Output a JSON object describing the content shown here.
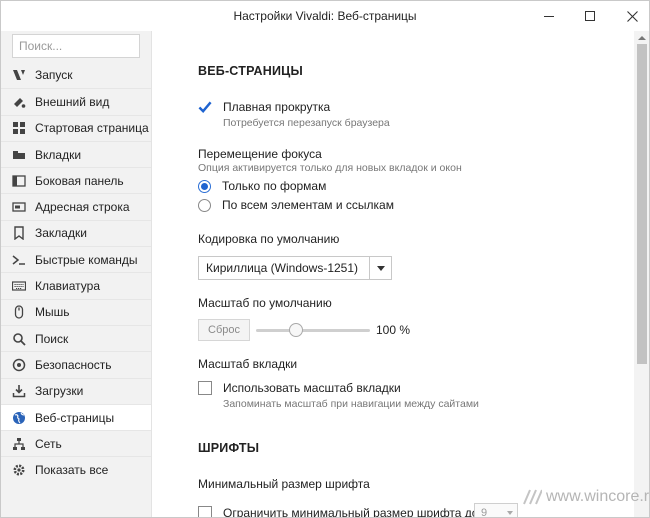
{
  "window": {
    "title": "Настройки Vivaldi: Веб-страницы"
  },
  "sidebar": {
    "search_placeholder": "Поиск...",
    "items": [
      {
        "label": "Запуск",
        "icon": "startup-icon",
        "active": false
      },
      {
        "label": "Внешний вид",
        "icon": "appearance-icon",
        "active": false
      },
      {
        "label": "Стартовая страница",
        "icon": "start-page-icon",
        "active": false
      },
      {
        "label": "Вкладки",
        "icon": "tabs-icon",
        "active": false
      },
      {
        "label": "Боковая панель",
        "icon": "side-panel-icon",
        "active": false
      },
      {
        "label": "Адресная строка",
        "icon": "address-bar-icon",
        "active": false
      },
      {
        "label": "Закладки",
        "icon": "bookmark-icon",
        "active": false
      },
      {
        "label": "Быстрые команды",
        "icon": "quick-commands-icon",
        "active": false
      },
      {
        "label": "Клавиатура",
        "icon": "keyboard-icon",
        "active": false
      },
      {
        "label": "Мышь",
        "icon": "mouse-icon",
        "active": false
      },
      {
        "label": "Поиск",
        "icon": "search-icon",
        "active": false
      },
      {
        "label": "Безопасность",
        "icon": "security-icon",
        "active": false
      },
      {
        "label": "Загрузки",
        "icon": "downloads-icon",
        "active": false
      },
      {
        "label": "Веб-страницы",
        "icon": "globe-icon",
        "active": true
      },
      {
        "label": "Сеть",
        "icon": "network-icon",
        "active": false
      },
      {
        "label": "Показать все",
        "icon": "gear-icon",
        "active": false
      }
    ]
  },
  "main": {
    "section_webpages": "ВЕБ-СТРАНИЦЫ",
    "smooth_scroll": {
      "label": "Плавная прокрутка",
      "hint": "Потребуется перезапуск браузера",
      "checked": true
    },
    "focus": {
      "title": "Перемещение фокуса",
      "hint": "Опция активируется только для новых вкладок и окон",
      "options": [
        {
          "label": "Только по формам",
          "checked": true
        },
        {
          "label": "По всем элементам и ссылкам",
          "checked": false
        }
      ]
    },
    "encoding": {
      "title": "Кодировка по умолчанию",
      "value": "Кириллица (Windows-1251)"
    },
    "zoom": {
      "title": "Масштаб по умолчанию",
      "reset_label": "Сброс",
      "value_text": "100 %",
      "slider_fraction": 0.33
    },
    "tab_zoom": {
      "title": "Масштаб вкладки",
      "label": "Использовать масштаб вкладки",
      "hint": "Запоминать масштаб при навигации между сайтами",
      "checked": false
    },
    "section_fonts": "ШРИФТЫ",
    "min_font": {
      "title": "Минимальный размер шрифта",
      "label": "Ограничить минимальный размер шрифта до",
      "value": "9",
      "checked": false
    }
  },
  "watermark": "www.wincore.ru",
  "colors": {
    "accent": "#1e63d0",
    "sidebar_bg": "#f2f2f2",
    "active_item_bg": "#ffffff"
  }
}
